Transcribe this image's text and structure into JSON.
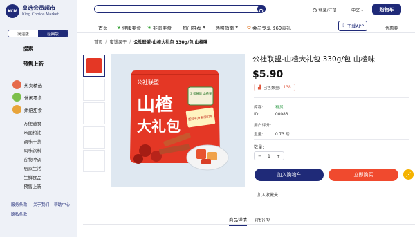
{
  "brand": {
    "name_cn": "皇选会员超市",
    "name_en": "King Choice Market",
    "badge": "KCM"
  },
  "sidebar": {
    "mode_tabs": [
      "简洁版",
      "经典版"
    ],
    "active_mode": 1,
    "search": "搜索",
    "presale": "预售上新",
    "categories": [
      {
        "label": "热卖精选",
        "icon": "hot-products-icon",
        "color": "#e66b4b"
      },
      {
        "label": "休闲零食",
        "icon": "snacks-icon",
        "color": "#7cbf4b"
      },
      {
        "label": "烘焙甜食",
        "icon": "bakery-icon",
        "color": "#e8a43b"
      }
    ],
    "sub_items": [
      "方便速食",
      "米面粮油",
      "调味干货",
      "风味饮料",
      "谷物冲调",
      "居家生活",
      "生鲜食品",
      "预售上新"
    ],
    "footer_links": [
      "服务条款",
      "关于我们",
      "帮助中心",
      "隐私条款"
    ]
  },
  "header": {
    "search_placeholder": "",
    "login": "登录/注册",
    "language": "中文",
    "cart": "购物车"
  },
  "nav": {
    "items": [
      "首页",
      "健康美食",
      "非遗美食",
      "热门推荐",
      "选购指南",
      "会员专享 $69豪礼"
    ],
    "download": "下载APP",
    "promo": "优惠券"
  },
  "breadcrumb": [
    "首页",
    "蜜饯果干",
    "公社联盟-山楂大礼包 330g/包 山楂味"
  ],
  "product": {
    "title": "公社联盟-山楂大礼包 330g/包 山楂味",
    "price": "$5.90",
    "sold_label": "已售数量:",
    "sold_count": "138",
    "stock_label": "库存:",
    "stock_value": "有货",
    "id_label": "ID:",
    "id_value": "00083",
    "rating_label": "用户评分:",
    "weight_label": "重量:",
    "weight_value": "0.73 磅",
    "qty_label": "数量:",
    "qty_value": "1",
    "add_to_cart": "加入购物车",
    "buy_now": "立即购买",
    "favorite": "加入收藏夹"
  },
  "package_art": {
    "brand": "公社联盟",
    "name_line1": "山楂",
    "name_line2": "大礼包",
    "tag1": "3 蛋黄酥 山楂果",
    "tag2": "配料干净 鲜果打浆"
  },
  "tabs": [
    "商品详情",
    "评价(4)"
  ],
  "colors": {
    "primary": "#1f2a78",
    "buy": "#f04a2e",
    "share": "#f5b300",
    "price": "#111111"
  }
}
